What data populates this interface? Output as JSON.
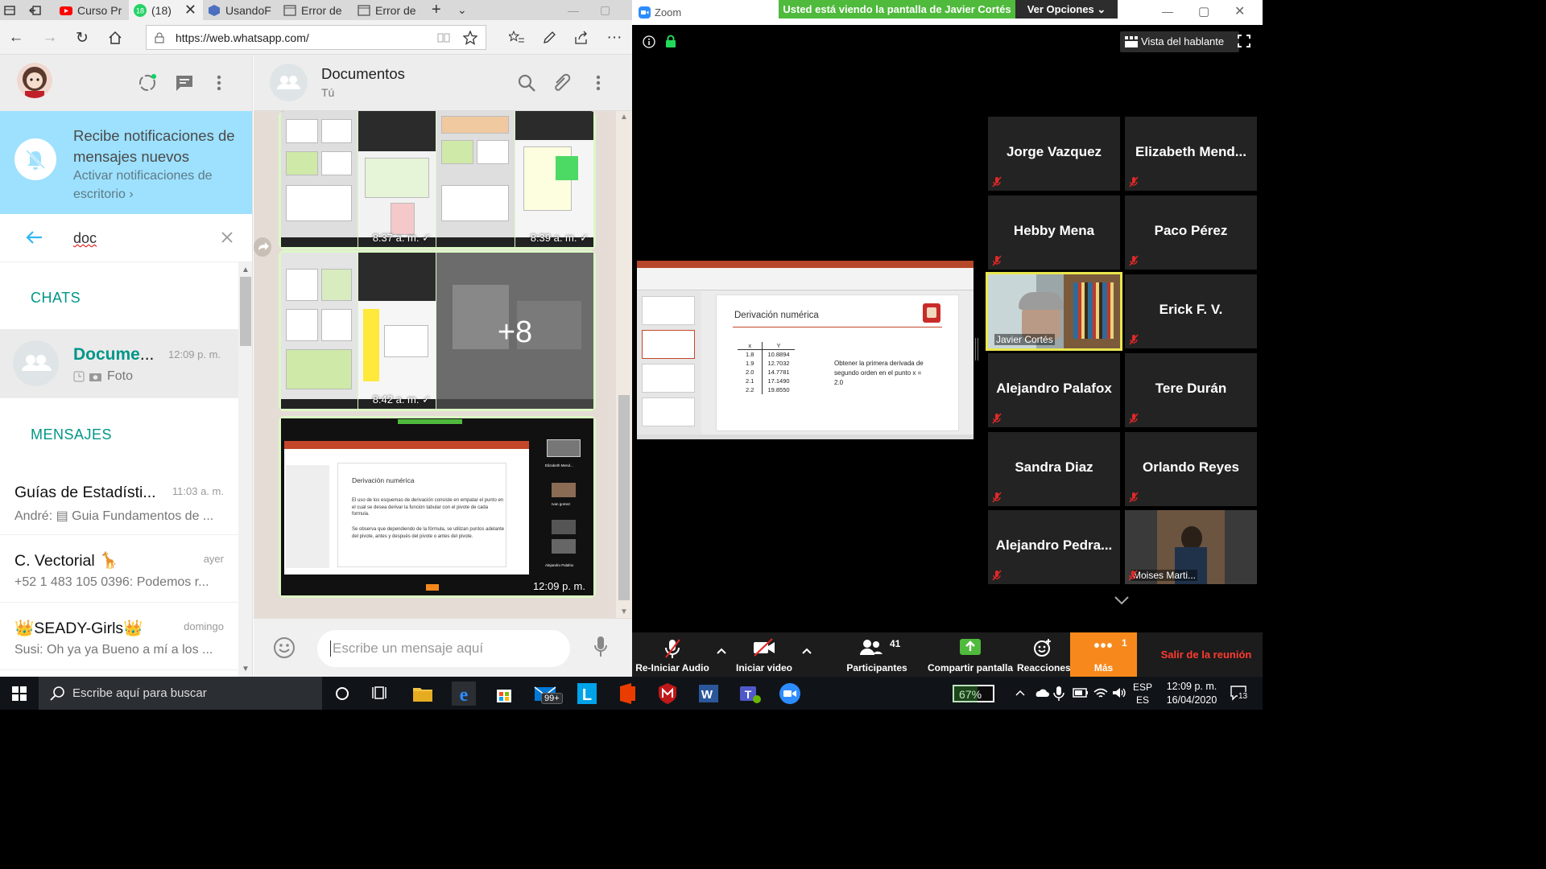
{
  "browser": {
    "tabs": [
      {
        "label": "Curso Pr",
        "icon": "youtube-icon",
        "active": false
      },
      {
        "label": "(18)",
        "icon": "whatsapp-icon",
        "active": true
      },
      {
        "label": "UsandoF",
        "icon": "cube-icon",
        "active": false
      },
      {
        "label": "Error de",
        "icon": "page-icon",
        "active": false
      },
      {
        "label": "Error de",
        "icon": "page-icon",
        "active": false
      }
    ],
    "url": "https://web.whatsapp.com/"
  },
  "whatsapp": {
    "notification": {
      "title": "Recibe notificaciones de mensajes nuevos",
      "action": "Activar notificaciones de escritorio",
      "action_suffix": "›"
    },
    "search": {
      "query": "doc"
    },
    "sections": {
      "chats": "CHATS",
      "messages": "MENSAJES"
    },
    "chat_results": [
      {
        "name_match": "Docume",
        "name_rest": "...",
        "time": "12:09 p. m.",
        "last": "Foto"
      }
    ],
    "message_results": [
      {
        "name": "Guías de Estadísti...",
        "time": "11:03 a. m.",
        "last": "André: ▤ Guia Fundamentos de ..."
      },
      {
        "name": "C. Vectorial 🦒",
        "time": "ayer",
        "last": "+52 1 483 105 0396: Podemos r..."
      },
      {
        "name": "👑SEADY-Girls👑",
        "time": "domingo",
        "last": "Susi: Oh ya ya Bueno a mí a los ..."
      }
    ],
    "open_chat": {
      "title": "Documentos",
      "subtitle": "Tú"
    },
    "media_stamps": [
      "8:37 a. m. ✓",
      "8:39 a. m. ✓",
      "8:42 a. m. ✓",
      "12:09 p. m."
    ],
    "more_count": "+8",
    "compose_placeholder": "Escribe un mensaje aquí",
    "preview_slide": {
      "title": "Derivación numérica",
      "p1": "El uso de los esquemas de derivación consiste en empatar el punto en el cual se desea derivar la función tabular con el pivote de cada formula.",
      "p2": "Se observa que dependiendo de la fórmula, se utilizan puntos adelante del pivote, antes y después del pivote o antes del pivote.",
      "names": [
        "Elizabeth Mend...",
        "Ivan gomez",
        "Alejandro Palafox"
      ]
    }
  },
  "zoom": {
    "app_title": "Zoom",
    "share_banner": "Usted está viendo la pantalla de Javier Cortés",
    "view_options": "Ver Opciones ⌄",
    "speaker_view": "Vista del hablante",
    "slide": {
      "title": "Derivación numérica",
      "table_headers": [
        "x",
        "Y"
      ],
      "table_rows": [
        [
          "1.8",
          "10.8894"
        ],
        [
          "1.9",
          "12.7032"
        ],
        [
          "2.0",
          "14.7781"
        ],
        [
          "2.1",
          "17.1490"
        ],
        [
          "2.2",
          "19.8550"
        ]
      ],
      "note": "Obtener la primera derivada de segundo orden en el punto x = 2.0"
    },
    "participants": [
      {
        "name": "Jorge Vazquez",
        "video": false
      },
      {
        "name": "Elizabeth  Mend...",
        "video": false
      },
      {
        "name": "Hebby Mena",
        "video": false
      },
      {
        "name": "Paco Pérez",
        "video": false
      },
      {
        "name": "Javier Cortés",
        "video": true,
        "active_speaker": true
      },
      {
        "name": "Erick F. V.",
        "video": false
      },
      {
        "name": "Alejandro Palafox",
        "video": false
      },
      {
        "name": "Tere Durán",
        "video": false
      },
      {
        "name": "Sandra Diaz",
        "video": false
      },
      {
        "name": "Orlando Reyes",
        "video": false
      },
      {
        "name": "Alejandro  Pedra...",
        "video": false
      },
      {
        "name": "Moises Marti...",
        "video": true,
        "active_speaker": false
      }
    ],
    "controls": {
      "audio": "Re-Iniciar Audio",
      "video": "Iniciar video",
      "participants": "Participantes",
      "participants_count": "41",
      "share": "Compartir pantalla",
      "reactions": "Reacciones",
      "more": "Más",
      "more_badge": "1",
      "leave": "Salir de la reunión"
    },
    "colors": {
      "share_green": "#4fba3c",
      "more_orange": "#f7891c",
      "leave_red": "#ff3b30",
      "speaker_yellow": "#e9e64f"
    }
  },
  "taskbar": {
    "search_placeholder": "Escribe aquí para buscar",
    "mail_badge": "99+",
    "battery": "67%",
    "language": [
      "ESP",
      "ES"
    ],
    "time": "12:09 p. m.",
    "date": "16/04/2020",
    "notifications": "13"
  }
}
